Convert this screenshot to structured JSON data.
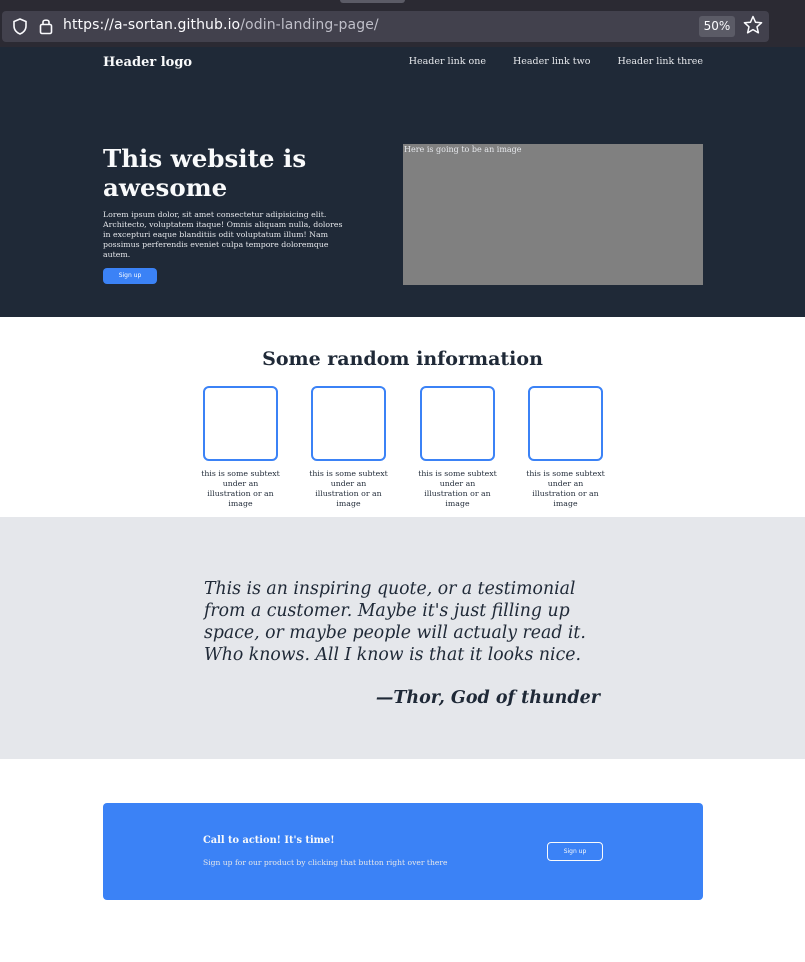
{
  "browser": {
    "url_host": "https://a-sortan.github.io",
    "url_path": "/odin-landing-page/",
    "zoom": "50%"
  },
  "header": {
    "logo": "Header logo",
    "links": [
      "Header link one",
      "Header link two",
      "Header link three"
    ]
  },
  "hero": {
    "title": "This website is awesome",
    "text": "Lorem ipsum dolor, sit amet consectetur adipisicing elit. Architecto, voluptatem itaque! Omnis aliquam nulla, dolores in excepturi eaque blanditiis odit voluptatum illum! Nam possimus perferendis eveniet culpa tempore doloremque autem.",
    "button": "Sign up",
    "image_placeholder": "Here is going to be an image"
  },
  "info": {
    "title": "Some random information",
    "captions": [
      "this is some subtext under an illustration or an image",
      "this is some subtext under an illustration or an image",
      "this is some subtext under an illustration or an image",
      "this is some subtext under an illustration or an image"
    ]
  },
  "quote": {
    "text": "This is an inspiring quote, or a testimonial from a customer. Maybe it's just filling up space, or maybe people will actualy read it. Who knows. All I know is that it looks nice.",
    "author": "—Thor, God of thunder"
  },
  "cta": {
    "title": "Call to action! It's time!",
    "text": "Sign up for our product by clicking that button right over there",
    "button": "Sign up"
  },
  "colors": {
    "hero_bg": "#1f2937",
    "accent": "#3b82f6",
    "quote_bg": "#e5e7eb",
    "image_placeholder": "#808080"
  },
  "icons": [
    "shield-icon",
    "lock-icon",
    "star-icon"
  ]
}
